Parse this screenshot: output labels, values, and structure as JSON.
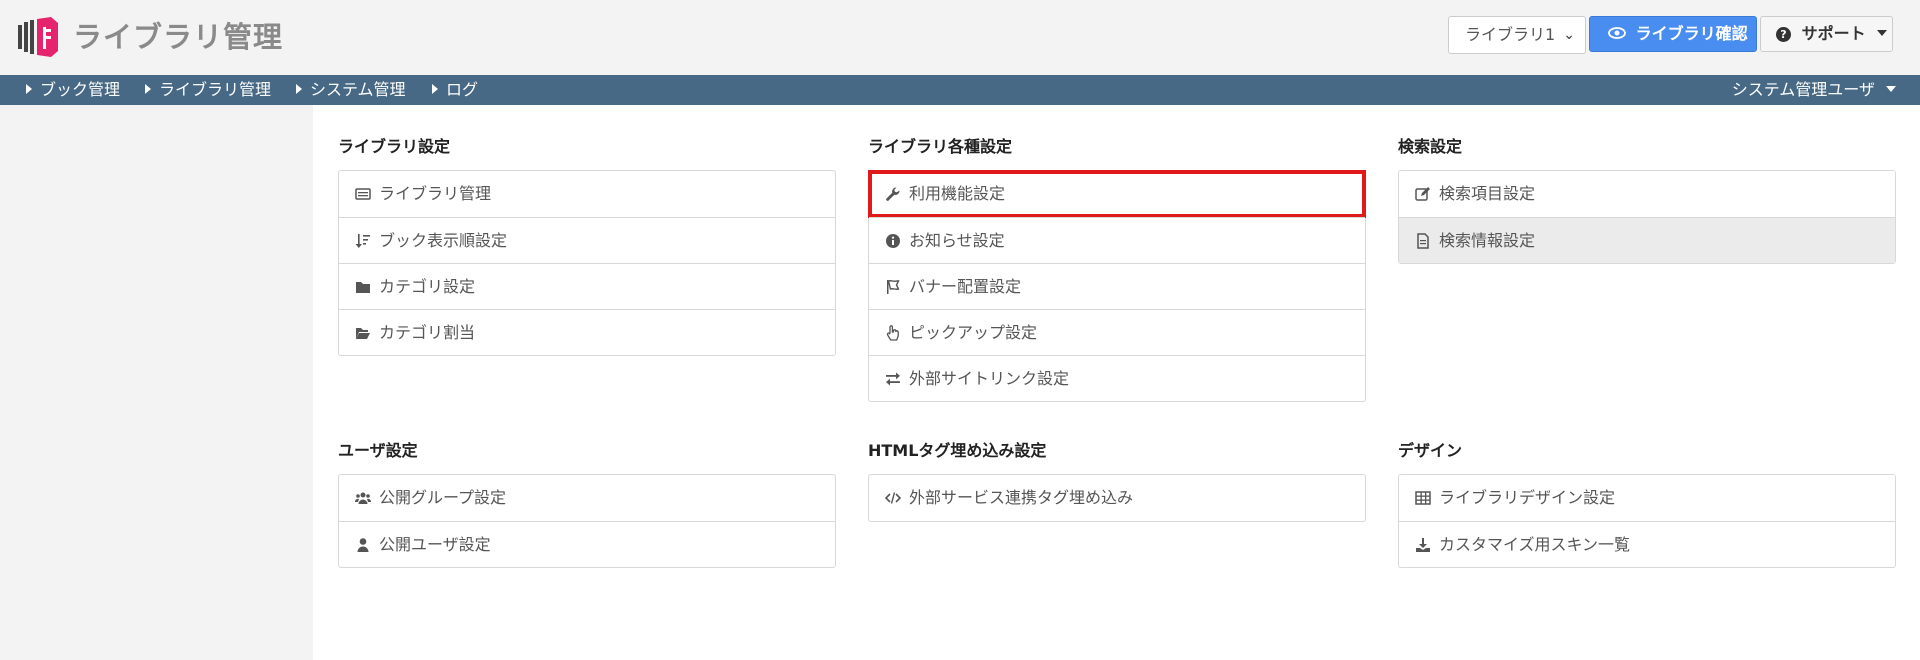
{
  "header": {
    "app_title": "ライブラリ管理",
    "library_select": "ライブラリ1",
    "confirm_button": "ライブラリ確認",
    "support_button": "サポート"
  },
  "nav": {
    "items": [
      "ブック管理",
      "ライブラリ管理",
      "システム管理",
      "ログ"
    ],
    "user": "システム管理ユーザ"
  },
  "sections": {
    "library": {
      "title": "ライブラリ設定",
      "items": [
        {
          "label": "ライブラリ管理",
          "icon": "list-icon"
        },
        {
          "label": "ブック表示順設定",
          "icon": "sort-icon"
        },
        {
          "label": "カテゴリ設定",
          "icon": "folder-icon"
        },
        {
          "label": "カテゴリ割当",
          "icon": "folder-open-icon"
        }
      ]
    },
    "various": {
      "title": "ライブラリ各種設定",
      "items": [
        {
          "label": "利用機能設定",
          "icon": "wrench-icon"
        },
        {
          "label": "お知らせ設定",
          "icon": "info-icon"
        },
        {
          "label": "バナー配置設定",
          "icon": "flag-icon"
        },
        {
          "label": "ピックアップ設定",
          "icon": "hand-pointer-icon"
        },
        {
          "label": "外部サイトリンク設定",
          "icon": "exchange-icon"
        }
      ]
    },
    "search": {
      "title": "検索設定",
      "items": [
        {
          "label": "検索項目設定",
          "icon": "edit-icon"
        },
        {
          "label": "検索情報設定",
          "icon": "file-icon"
        }
      ]
    },
    "users": {
      "title": "ユーザ設定",
      "items": [
        {
          "label": "公開グループ設定",
          "icon": "users-icon"
        },
        {
          "label": "公開ユーザ設定",
          "icon": "user-icon"
        }
      ]
    },
    "html": {
      "title": "HTMLタグ埋め込み設定",
      "items": [
        {
          "label": "外部サービス連携タグ埋め込み",
          "icon": "code-icon"
        }
      ]
    },
    "design": {
      "title": "デザイン",
      "items": [
        {
          "label": "ライブラリデザイン設定",
          "icon": "table-icon"
        },
        {
          "label": "カスタマイズ用スキン一覧",
          "icon": "download-icon"
        }
      ]
    }
  },
  "colors": {
    "nav_bg": "#476985",
    "primary_button": "#4a8df0",
    "logo_pink": "#e6246e",
    "highlight_border": "#e01a1a"
  }
}
